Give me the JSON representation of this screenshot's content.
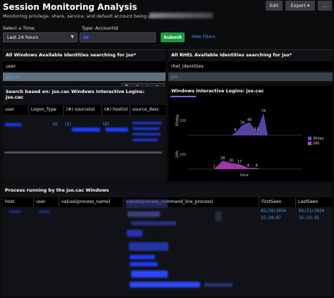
{
  "header": {
    "title": "Session Monitoring Analysis",
    "subtitle": "Monitoring privilege, share, service, and default account being used i",
    "edit_label": "Edit",
    "export_label": "Export ▾",
    "more_label": "..."
  },
  "filters": {
    "time_label": "Select a Time:",
    "time_value": "Last 24 hours",
    "type_label": "Type: AccountId",
    "submit_label": "Submit",
    "hide_filters_label": "Hide Filters"
  },
  "panels": {
    "windows_identities": {
      "title": "All Windows Available Identities searching for jso*",
      "column": "user",
      "row_value": "jso.cac"
    },
    "rhel_identities": {
      "title": "All RHEL Available Identities searching for jso*",
      "column": "rhel_identities",
      "row_value": "jso"
    },
    "interactive_logins": {
      "title_line1": "Search based on: jso.cac Windows Interactive Logins:",
      "title_line2": "jso.cac",
      "columns": [
        "user",
        "Logon_Type",
        "(#) source(s)",
        "(#) host(s)",
        "source_desc"
      ],
      "row": {
        "logon_type": "10",
        "sources": "(2)",
        "hosts": "(2)"
      }
    },
    "windows_chart": {
      "title": "Windows Interactive Logins: jso.cac",
      "toolbar": [
        "🔍",
        "⬇",
        "ℹ",
        "◼"
      ]
    },
    "process_table": {
      "title": "Process running by the jso.cac Windows",
      "columns": [
        "host",
        "user",
        "values(process_name)",
        "values(process_command_line_process)",
        "FirstSeen",
        "LastSeen"
      ],
      "first_seen_date": "05/20/2024",
      "first_seen_time": "15:29:07",
      "last_seen_date": "05/21/2024",
      "last_seen_time": "15:23:35"
    }
  },
  "chart_data": {
    "type": "area",
    "xlabel": "hour",
    "legend": [
      "30day",
      "24h"
    ],
    "legend_placement": "right",
    "colors": {
      "30day": "#6a4fc4",
      "24h": "#c040c0"
    },
    "series": [
      {
        "name": "30day",
        "ylabel": "30day",
        "ytick": "100",
        "peak_labels": [
          "9",
          "34",
          "44",
          "12",
          "74"
        ],
        "values": [
          9,
          34,
          44,
          12,
          74
        ]
      },
      {
        "name": "24h",
        "ylabel": "24h",
        "ytick": "100",
        "peak_labels": [
          "1",
          "28",
          "20",
          "17",
          "4",
          "4"
        ],
        "values": [
          1,
          28,
          20,
          17,
          4,
          4
        ]
      }
    ]
  }
}
